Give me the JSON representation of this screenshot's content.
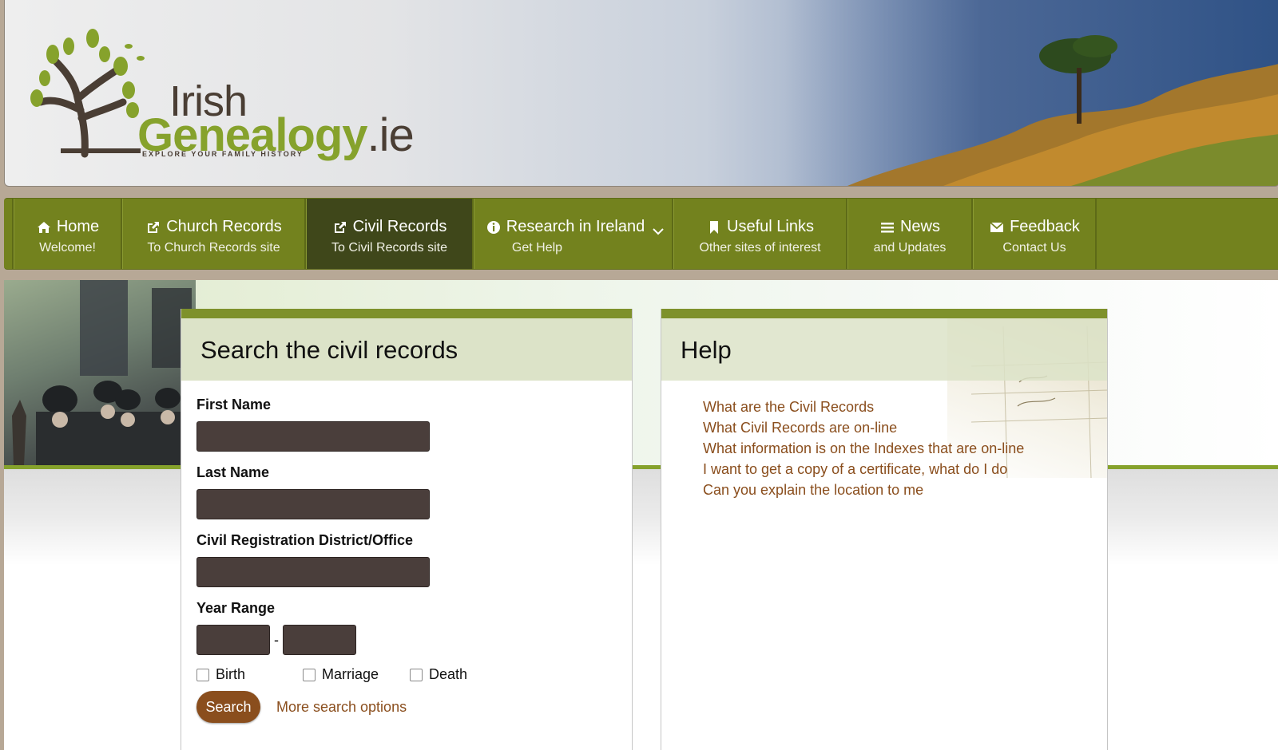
{
  "logo": {
    "irish": "Irish",
    "genealogy": "Genealogy",
    "ie": ".ie",
    "tagline": "EXPLORE YOUR FAMILY HISTORY"
  },
  "nav": {
    "items": [
      {
        "title": "Home",
        "sub": "Welcome!",
        "icon": "home-icon"
      },
      {
        "title": "Church Records",
        "sub": "To Church Records site",
        "icon": "external-link-icon"
      },
      {
        "title": "Civil Records",
        "sub": "To Civil Records site",
        "icon": "external-link-icon"
      },
      {
        "title": "Research in Ireland",
        "sub": "Get Help",
        "icon": "info-icon"
      },
      {
        "title": "Useful Links",
        "sub": "Other sites of interest",
        "icon": "bookmark-icon"
      },
      {
        "title": "News",
        "sub": "and Updates",
        "icon": "list-icon"
      },
      {
        "title": "Feedback",
        "sub": "Contact Us",
        "icon": "envelope-icon"
      }
    ]
  },
  "search": {
    "heading": "Search the civil records",
    "first_name_label": "First Name",
    "last_name_label": "Last Name",
    "district_label": "Civil Registration District/Office",
    "year_range_label": "Year Range",
    "year_separator": "-",
    "types": [
      "Birth",
      "Marriage",
      "Death"
    ],
    "search_button": "Search",
    "more_options": "More search options"
  },
  "help": {
    "heading": "Help",
    "links": [
      "What are the Civil Records",
      "What Civil Records are on-line",
      "What information is on the Indexes that are on-line",
      "I want to get a copy of a certificate, what do I do",
      "Can you explain the location to me"
    ]
  },
  "colors": {
    "nav_green": "#73821e",
    "nav_active": "#3f471a",
    "brand_green": "#86a22c",
    "link_brown": "#8a4e1d",
    "field_dark": "#4a3e3b"
  }
}
